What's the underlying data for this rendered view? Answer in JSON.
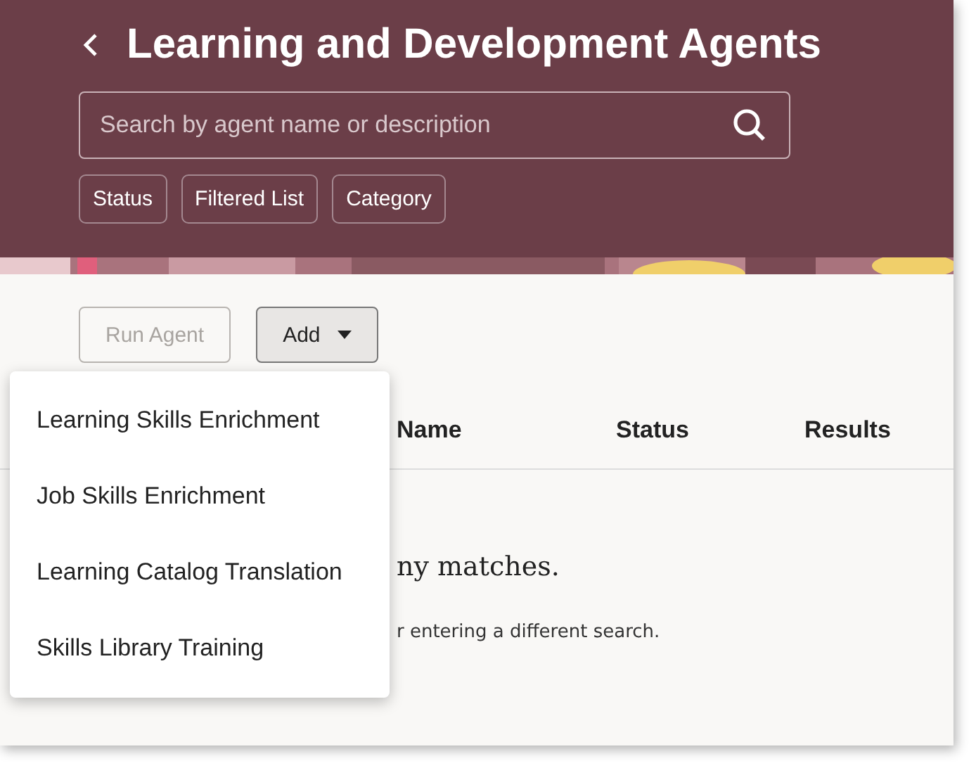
{
  "header": {
    "title": "Learning and Development Agents",
    "search": {
      "placeholder": "Search by agent name or description"
    },
    "filters": [
      "Status",
      "Filtered List",
      "Category"
    ],
    "banner": {
      "kind": "picture"
    }
  },
  "toolbar": {
    "buttons": [
      {
        "label": "Run Agent",
        "disabled": true,
        "kind": "plain"
      },
      {
        "label": "Add",
        "disabled": false,
        "kind": "menu",
        "expanded": true
      }
    ]
  },
  "table": {
    "columns": [
      "Name",
      "Status",
      "Results"
    ]
  },
  "empty_message": {
    "title": "ny matches.",
    "hint": "r entering a different search."
  },
  "add_menu": {
    "items": [
      "Learning Skills Enrichment",
      "Job Skills Enrichment",
      "Learning Catalog Translation",
      "Skills Library Training"
    ]
  }
}
